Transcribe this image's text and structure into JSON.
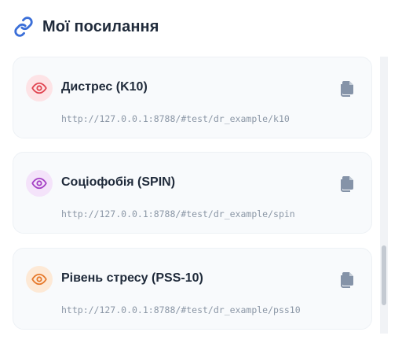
{
  "header": {
    "title": "Мої посилання",
    "icon": "link-icon"
  },
  "links": [
    {
      "title": "Дистрес (K10)",
      "url": "http://127.0.0.1:8788/#test/dr_example/k10",
      "icon": "eye-icon",
      "accent": "#e0434f",
      "accent_bg": "#fde3e6"
    },
    {
      "title": "Соціофобія (SPIN)",
      "url": "http://127.0.0.1:8788/#test/dr_example/spin",
      "icon": "eye-icon",
      "accent": "#a43fc4",
      "accent_bg": "#f4e3fa"
    },
    {
      "title": "Рівень стресу (PSS-10)",
      "url": "http://127.0.0.1:8788/#test/dr_example/pss10",
      "icon": "eye-icon",
      "accent": "#e6792b",
      "accent_bg": "#fde9d6"
    }
  ],
  "colors": {
    "link_icon": "#3b6fd8",
    "copy_icon": "#8593a8",
    "text": "#1f2a3a",
    "muted": "#8b97a6"
  }
}
